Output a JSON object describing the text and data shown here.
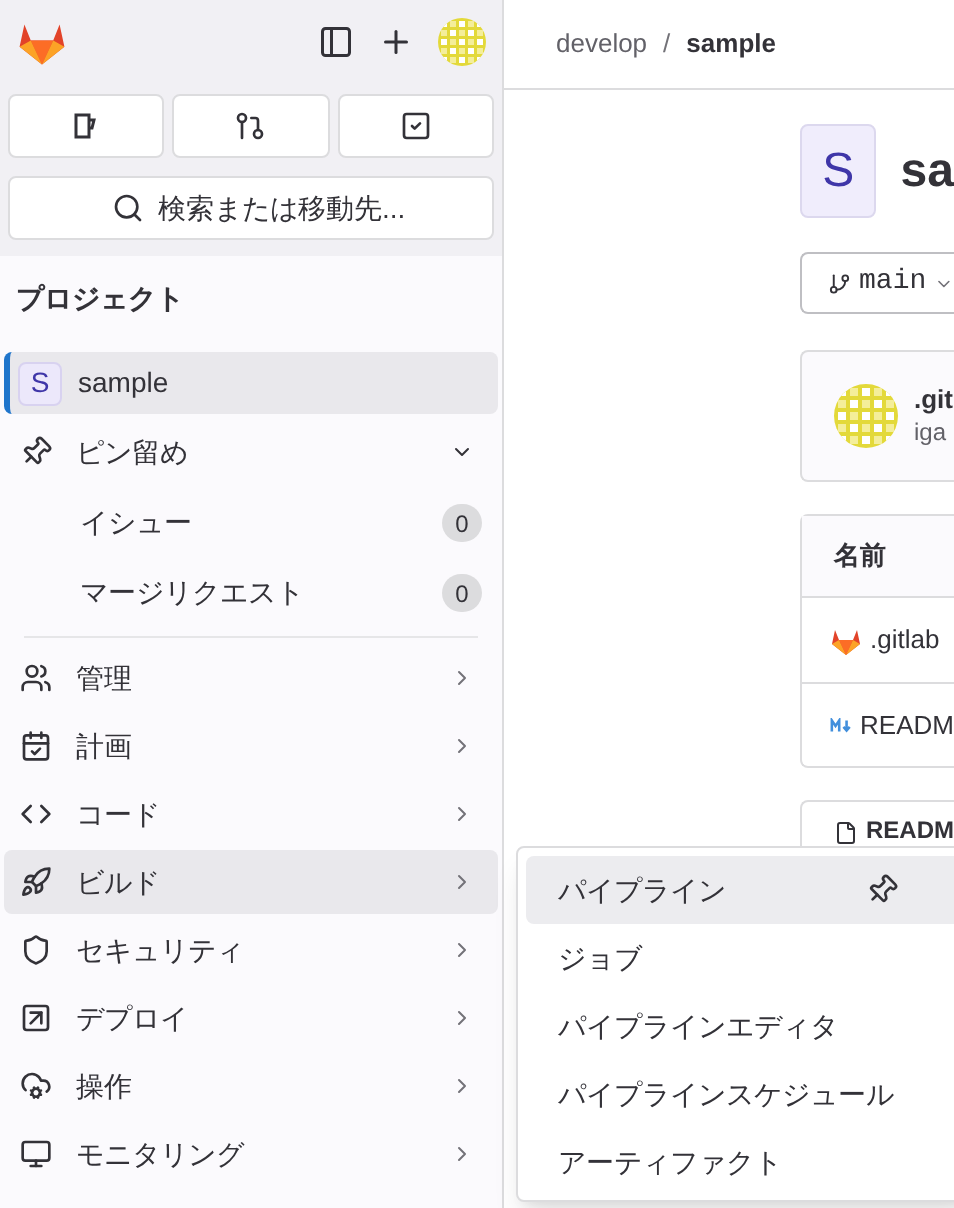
{
  "sidebar": {
    "search": {
      "placeholder": "検索または移動先..."
    },
    "section_title": "プロジェクト",
    "project": {
      "initial": "S",
      "name": "sample",
      "selected": true
    },
    "pinned": {
      "label": "ピン留め",
      "expanded": true,
      "items": [
        {
          "label": "イシュー",
          "count": "0"
        },
        {
          "label": "マージリクエスト",
          "count": "0"
        }
      ]
    },
    "items": [
      {
        "label": "管理",
        "selected": false
      },
      {
        "label": "計画",
        "selected": false
      },
      {
        "label": "コード",
        "selected": false
      },
      {
        "label": "ビルド",
        "selected": true
      },
      {
        "label": "セキュリティ",
        "selected": false
      },
      {
        "label": "デプロイ",
        "selected": false
      },
      {
        "label": "操作",
        "selected": false
      },
      {
        "label": "モニタリング",
        "selected": false
      }
    ]
  },
  "breadcrumb": [
    "develop",
    "sample"
  ],
  "breadcrumb_separator": "/",
  "project": {
    "initial": "S",
    "title": "sa",
    "branch": "main"
  },
  "commit": {
    "title": ".git",
    "author": "iga"
  },
  "files": {
    "header": "名前",
    "rows": [
      {
        "kind": "gitlab",
        "name": ".gitlab"
      },
      {
        "kind": "markdown",
        "name": "READM"
      }
    ]
  },
  "readme": {
    "title": "READM"
  },
  "flyout": [
    {
      "label": "パイプライン",
      "selected": true
    },
    {
      "label": "ジョブ",
      "selected": false
    },
    {
      "label": "パイプラインエディタ",
      "selected": false
    },
    {
      "label": "パイプラインスケジュール",
      "selected": false
    },
    {
      "label": "アーティファクト",
      "selected": false
    }
  ]
}
